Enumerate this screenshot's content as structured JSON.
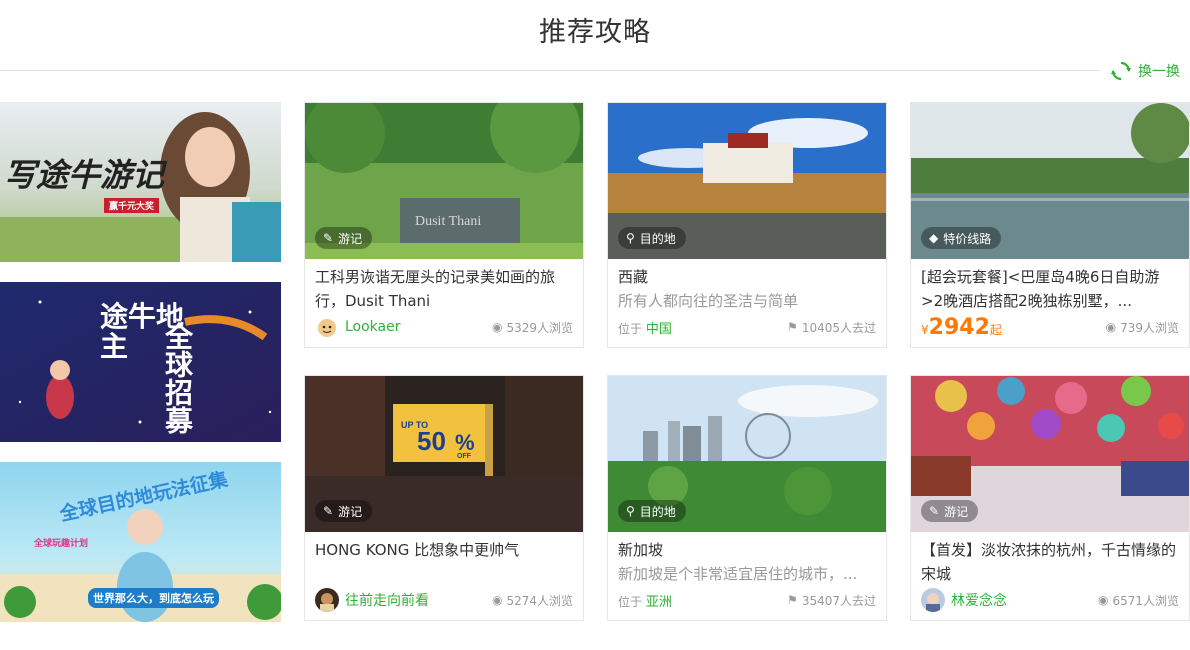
{
  "section_title": "推荐攻略",
  "refresh_label": "换一换",
  "banners": [
    {
      "text_main": "写途牛游记",
      "text_sub": "赢千元大奖"
    },
    {
      "text_main": "途牛地主",
      "text_sub": "全球招募"
    },
    {
      "text_main": "全球目的地玩法征集",
      "text_sub": "世界那么大，到底怎么玩",
      "text_tag": "全球玩趣计划"
    }
  ],
  "cards": [
    {
      "tag": "游记",
      "tag_icon": "pen-icon",
      "title": "工科男诙谐无厘头的记录美如画的旅行，Dusit Thani",
      "author": "Lookaer",
      "views": "5329人浏览"
    },
    {
      "tag": "目的地",
      "tag_icon": "location-pin-icon",
      "title": "西藏",
      "subtitle": "所有人都向往的圣洁与简单",
      "loc_prefix": "位于",
      "loc_place": "中国",
      "visited": "10405人去过"
    },
    {
      "tag": "特价线路",
      "tag_icon": "price-tag-icon",
      "title": "[超会玩套餐]<巴厘岛4晚6日自助游>2晚酒店搭配2晚独栋别墅，...",
      "price_symbol": "¥",
      "price": "2942",
      "price_suffix": "起",
      "views": "739人浏览"
    },
    {
      "tag": "游记",
      "tag_icon": "pen-icon",
      "title": "HONG KONG 比想象中更帅气",
      "author": "往前走向前看",
      "views": "5274人浏览",
      "sign_left": "UP TO",
      "sign_big": "50",
      "sign_pct": "%",
      "sign_off": "OFF"
    },
    {
      "tag": "目的地",
      "tag_icon": "location-pin-icon",
      "title": "新加坡",
      "subtitle": "新加坡是个非常适宜居住的城市，...",
      "loc_prefix": "位于",
      "loc_place": "亚洲",
      "visited": "35407人去过"
    },
    {
      "tag": "游记",
      "tag_icon": "pen-icon",
      "title": "【首发】淡妆浓抹的杭州，千古情缘的宋城",
      "author": "林爱念念",
      "views": "6571人浏览"
    }
  ],
  "colors": {
    "accent": "#2eb135",
    "price": "#ff7800",
    "muted": "#999999"
  }
}
